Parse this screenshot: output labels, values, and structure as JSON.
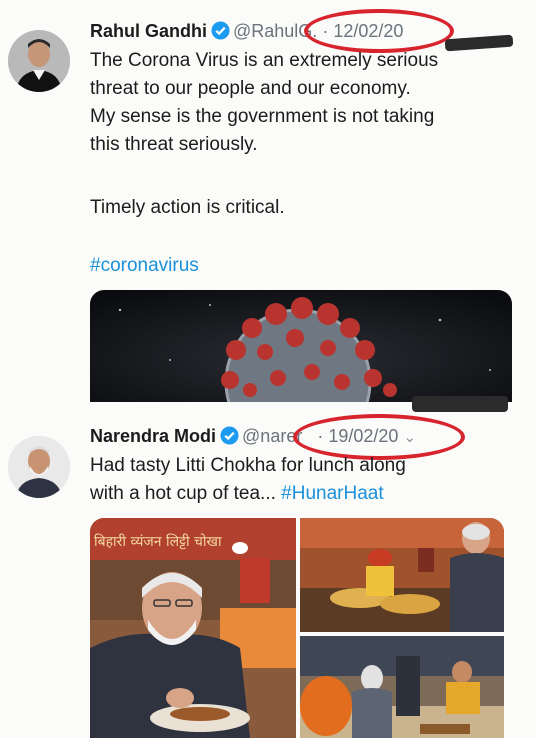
{
  "tweets": [
    {
      "author": "Rahul Gandhi",
      "handle": "@RahulG.",
      "separator": "·",
      "date": "12/02/20",
      "lines": [
        "The Corona Virus is an extremely serious",
        "threat to our people and our economy.",
        "My sense is the government is not taking",
        "this threat seriously."
      ],
      "line2": "Timely action is critical.",
      "hashtag": "#coronavirus"
    },
    {
      "author": "Narendra Modi",
      "handle": "@narer",
      "separator": "·",
      "date": "19/02/20",
      "line1": "Had tasty Litti Chokha for lunch along",
      "line2_prefix": "with a hot cup of tea...",
      "hashtag": "#HunarHaat",
      "sign_text": "बिहारी व्यंजन लिट्टी चोखा"
    }
  ],
  "colors": {
    "highlight": "#d7242d",
    "link": "#1a91da",
    "verified": "#1d9bf0"
  },
  "icons": [
    "verified-badge-icon",
    "chevron-down-icon"
  ]
}
